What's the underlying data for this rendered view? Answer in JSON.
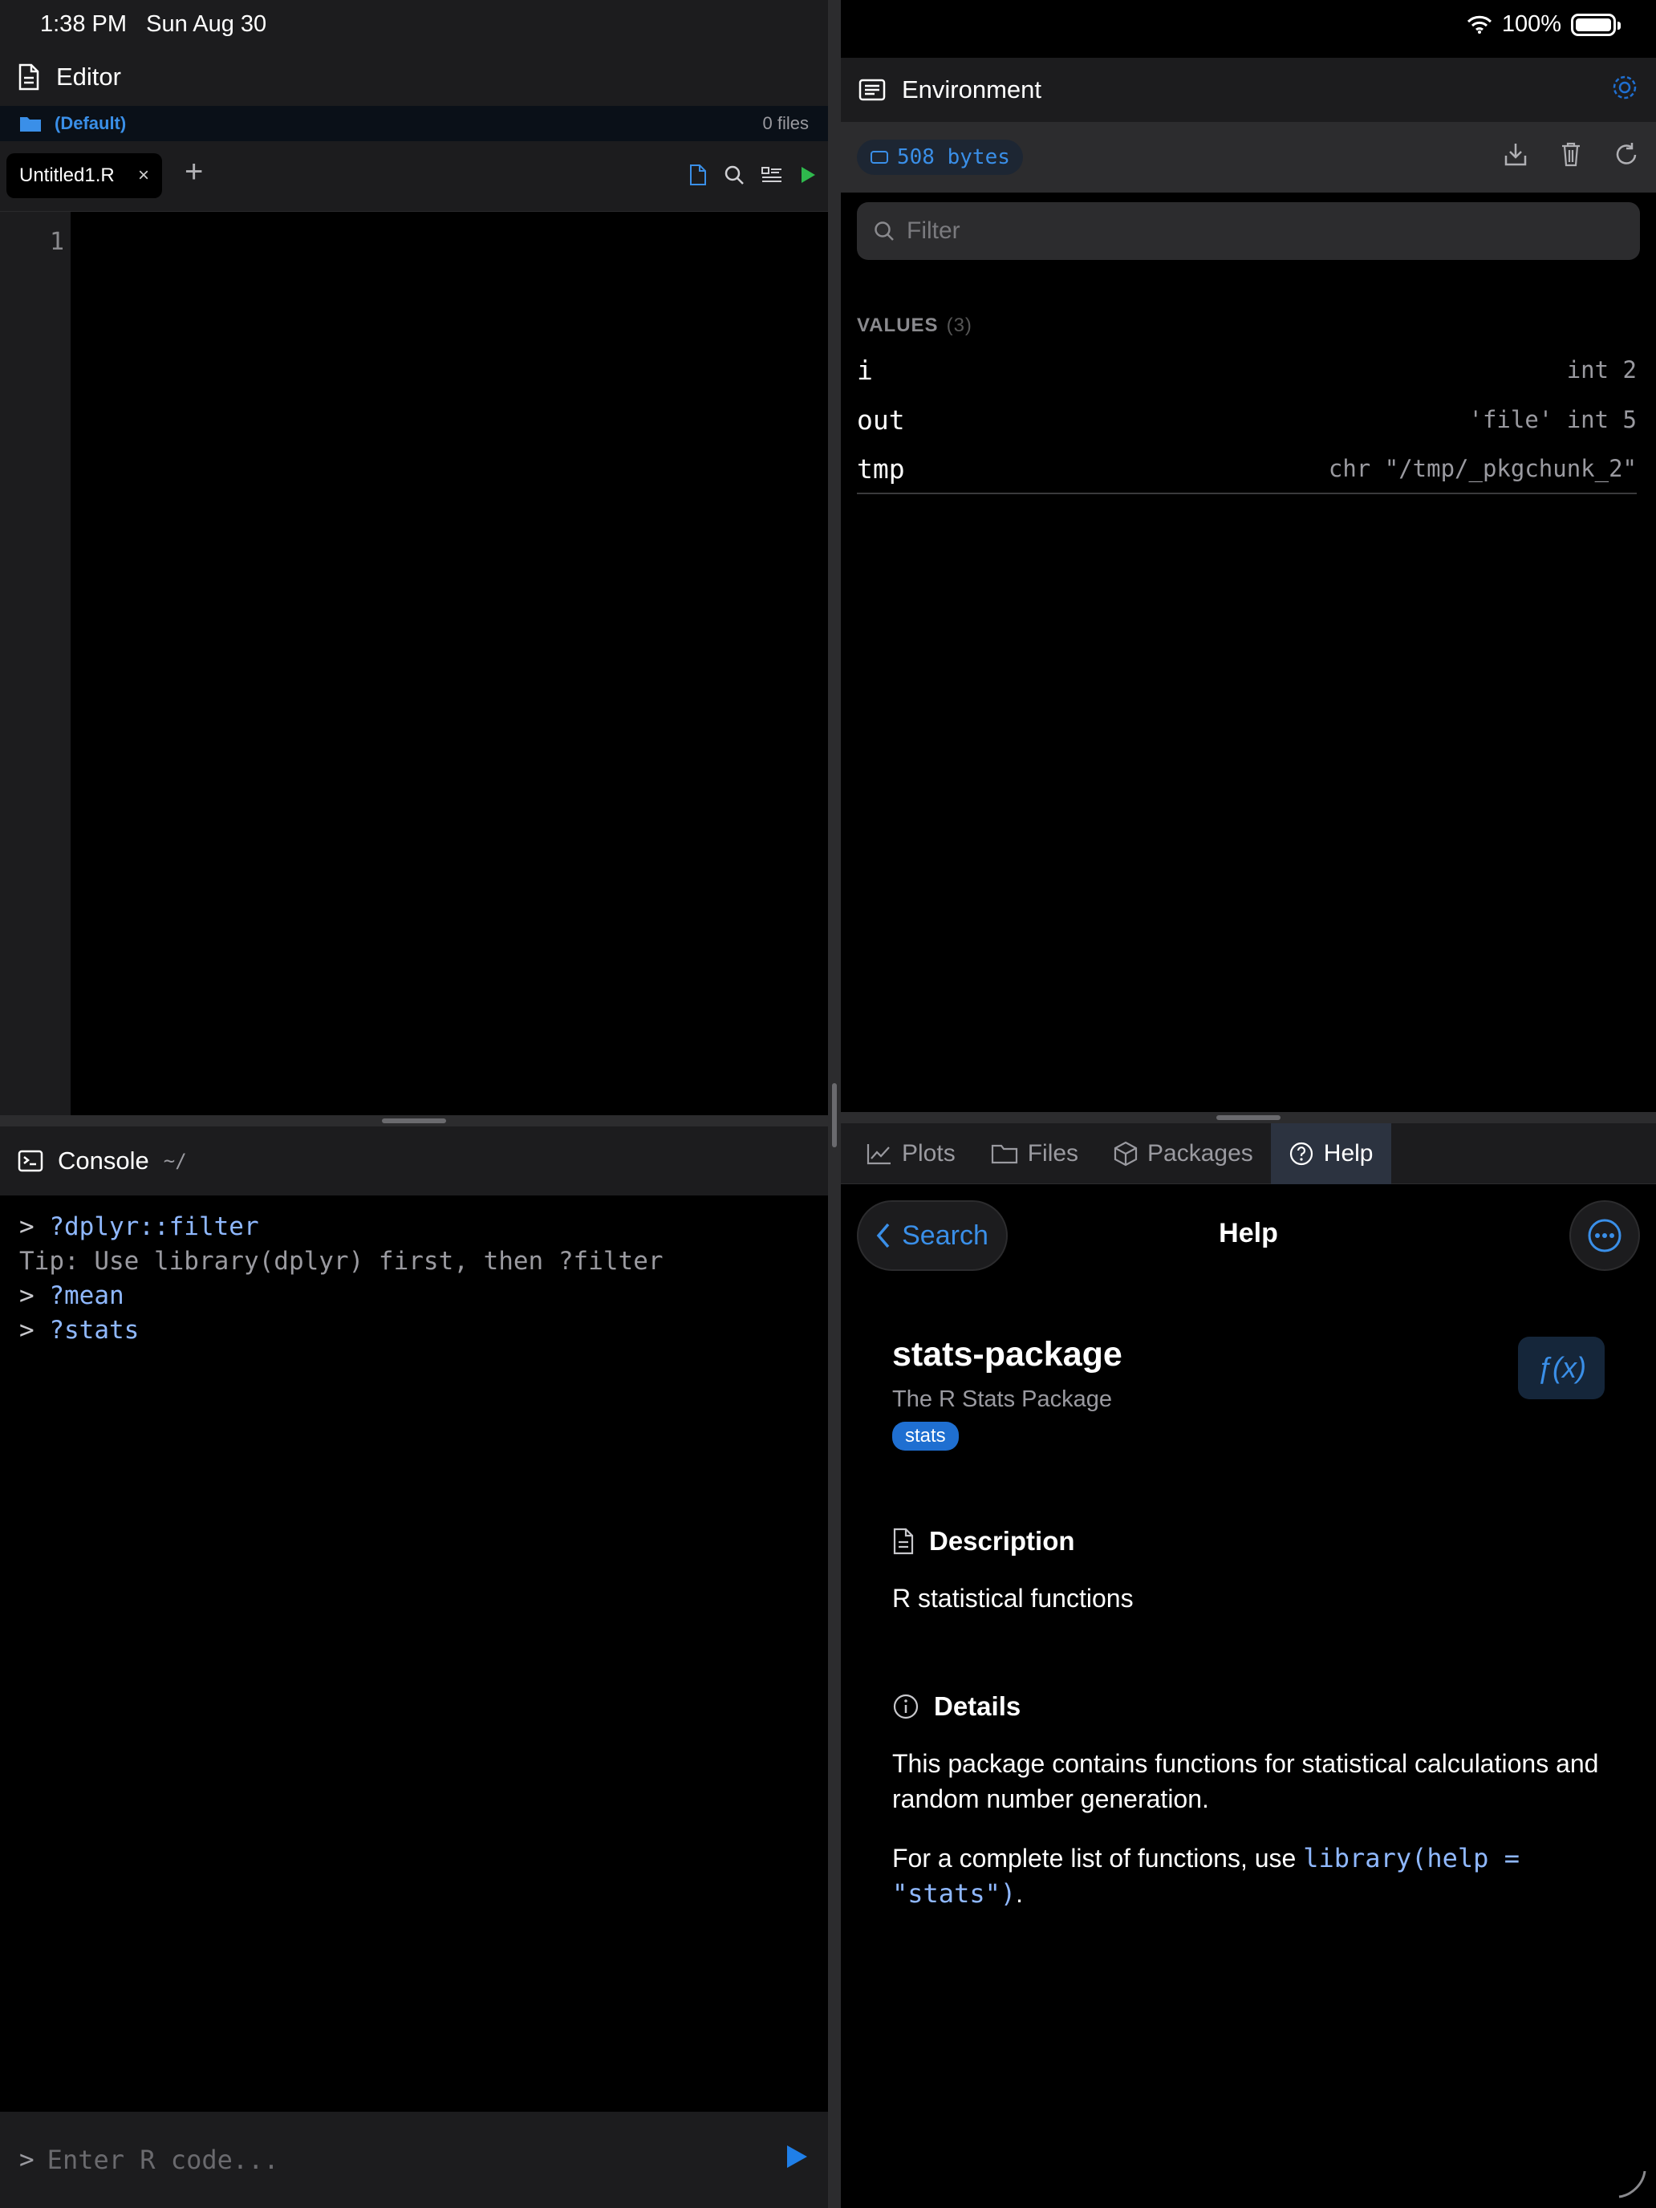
{
  "status": {
    "time": "1:38 PM",
    "date": "Sun Aug 30",
    "battery": "100%"
  },
  "editor": {
    "title": "Editor",
    "project": "(Default)",
    "file_count": "0 files",
    "tab": "Untitled1.R",
    "tab_close": "×",
    "add_tab": "+",
    "line_number": "1"
  },
  "console": {
    "title": "Console",
    "path": "~/",
    "lines": [
      {
        "prompt": "> ",
        "text": "?dplyr::filter",
        "kind": "cmd"
      },
      {
        "prompt": "",
        "text": "Tip: Use library(dplyr) first, then ?filter",
        "kind": "tip"
      },
      {
        "prompt": "> ",
        "text": "?mean",
        "kind": "cmd"
      },
      {
        "prompt": "> ",
        "text": "?stats",
        "kind": "cmd"
      }
    ],
    "input_prompt": ">",
    "input_placeholder": "Enter R code..."
  },
  "environment": {
    "title": "Environment",
    "memory": "508 bytes",
    "filter_placeholder": "Filter",
    "values_label": "VALUES",
    "values_count": "(3)",
    "values": [
      {
        "name": "i",
        "value": "int 2"
      },
      {
        "name": "out",
        "value": "'file' int 5"
      },
      {
        "name": "tmp",
        "value": "chr \"/tmp/_pkgchunk_2\""
      }
    ]
  },
  "bottom_tabs": [
    {
      "label": "Plots",
      "icon": "chart-line-icon"
    },
    {
      "label": "Files",
      "icon": "folder-icon"
    },
    {
      "label": "Packages",
      "icon": "package-icon"
    },
    {
      "label": "Help",
      "icon": "question-circle-icon",
      "active": true
    }
  ],
  "help": {
    "back_label": "Search",
    "title": "Help",
    "package_name": "stats-package",
    "package_subtitle": "The R Stats Package",
    "badge": "stats",
    "fx_label": "ƒ(x)",
    "description_heading": "Description",
    "description_text": "R statistical functions",
    "details_heading": "Details",
    "details_text": "This package contains functions for statistical calculations and random number generation.",
    "details_text2_prefix": "For a complete list of functions, use ",
    "details_text2_code": "library(help = \"stats\")",
    "details_text2_suffix": "."
  },
  "colors": {
    "accent": "#3a8fe8",
    "run_green": "#2fb84d",
    "code_blue": "#8fb8ff",
    "badge_blue": "#1f6fd1"
  }
}
